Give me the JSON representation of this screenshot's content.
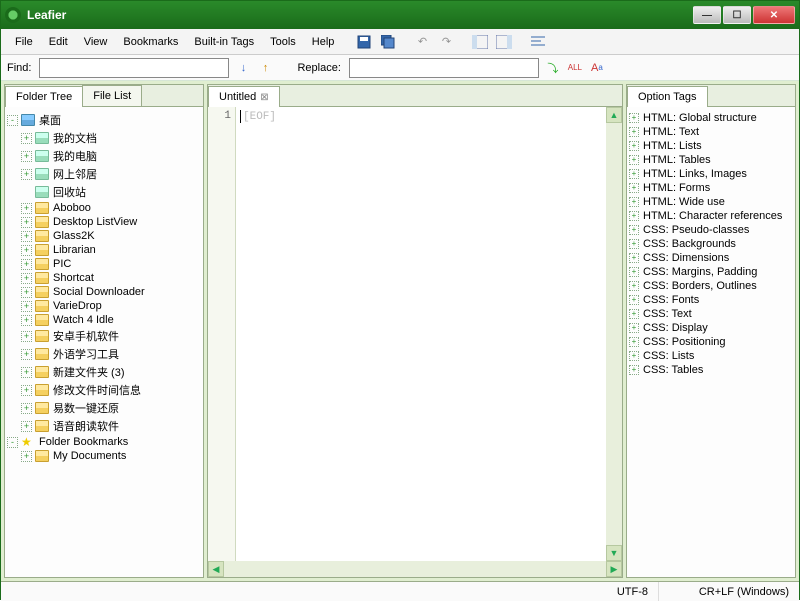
{
  "window": {
    "title": "Leafier"
  },
  "menu": {
    "items": [
      "File",
      "Edit",
      "View",
      "Bookmarks",
      "Built-in Tags",
      "Tools",
      "Help"
    ]
  },
  "toolbar_icons": [
    "save-icon",
    "save-all-icon",
    "undo-icon",
    "redo-icon",
    "layout1-icon",
    "layout2-icon",
    "align-icon"
  ],
  "findbar": {
    "find_label": "Find:",
    "find_value": "",
    "replace_label": "Replace:",
    "replace_value": ""
  },
  "left_tabs": {
    "items": [
      "Folder Tree",
      "File List"
    ],
    "active": 0
  },
  "tree": {
    "root": {
      "label": "桌面",
      "icon": "desktop",
      "expanded": true
    },
    "children": [
      {
        "label": "我的文档",
        "icon": "docfolder",
        "expandable": true
      },
      {
        "label": "我的电脑",
        "icon": "docfolder",
        "expandable": true
      },
      {
        "label": "网上邻居",
        "icon": "docfolder",
        "expandable": true
      },
      {
        "label": "回收站",
        "icon": "docfolder",
        "expandable": false
      },
      {
        "label": "Aboboo",
        "icon": "folder",
        "expandable": true
      },
      {
        "label": "Desktop ListView",
        "icon": "folder",
        "expandable": true
      },
      {
        "label": "Glass2K",
        "icon": "folder",
        "expandable": true
      },
      {
        "label": "Librarian",
        "icon": "folder",
        "expandable": true
      },
      {
        "label": "PIC",
        "icon": "folder",
        "expandable": true
      },
      {
        "label": "Shortcat",
        "icon": "folder",
        "expandable": true
      },
      {
        "label": "Social Downloader",
        "icon": "folder",
        "expandable": true
      },
      {
        "label": "VarieDrop",
        "icon": "folder",
        "expandable": true
      },
      {
        "label": "Watch 4 Idle",
        "icon": "folder",
        "expandable": true
      },
      {
        "label": "安卓手机软件",
        "icon": "folder",
        "expandable": true
      },
      {
        "label": "外语学习工具",
        "icon": "folder",
        "expandable": true
      },
      {
        "label": "新建文件夹 (3)",
        "icon": "folder",
        "expandable": true
      },
      {
        "label": "修改文件时间信息",
        "icon": "folder",
        "expandable": true
      },
      {
        "label": "易数一键还原",
        "icon": "folder",
        "expandable": true
      },
      {
        "label": "语音朗读软件",
        "icon": "folder",
        "expandable": true
      }
    ],
    "bookmarks_root": {
      "label": "Folder Bookmarks",
      "icon": "star",
      "expanded": true
    },
    "bookmarks": [
      {
        "label": "My Documents",
        "icon": "folder",
        "expandable": true
      }
    ]
  },
  "editor": {
    "tabs": [
      {
        "label": "Untitled",
        "active": true
      }
    ],
    "line_number": "1",
    "eof_marker": "[EOF]"
  },
  "right_tab": {
    "label": "Option Tags"
  },
  "option_tags": [
    "HTML: Global structure",
    "HTML: Text",
    "HTML: Lists",
    "HTML: Tables",
    "HTML: Links, Images",
    "HTML: Forms",
    "HTML: Wide use",
    "HTML: Character references",
    "CSS: Pseudo-classes",
    "CSS: Backgrounds",
    "CSS: Dimensions",
    "CSS: Margins, Padding",
    "CSS: Borders, Outlines",
    "CSS: Fonts",
    "CSS: Text",
    "CSS: Display",
    "CSS: Positioning",
    "CSS: Lists",
    "CSS: Tables"
  ],
  "statusbar": {
    "encoding": "UTF-8",
    "lineending": "CR+LF (Windows)"
  }
}
